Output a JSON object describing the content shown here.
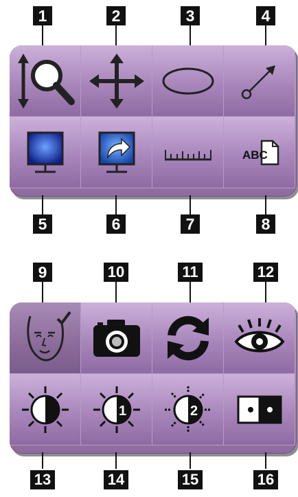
{
  "top_toolbar": {
    "callouts": [
      "1",
      "2",
      "3",
      "4",
      "5",
      "6",
      "7",
      "8"
    ],
    "tools": [
      {
        "icon": "zoom-magnifier-icon"
      },
      {
        "icon": "pan-move-icon"
      },
      {
        "icon": "ellipse-roi-icon"
      },
      {
        "icon": "arrow-annotation-icon"
      },
      {
        "icon": "monitor-icon"
      },
      {
        "icon": "monitor-share-icon"
      },
      {
        "icon": "ruler-icon"
      },
      {
        "icon": "text-annotation-icon",
        "text": "ABC"
      }
    ]
  },
  "bottom_toolbar": {
    "callouts": [
      "9",
      "10",
      "11",
      "12",
      "13",
      "14",
      "15",
      "16"
    ],
    "tools": [
      {
        "icon": "face-check-icon",
        "active": true
      },
      {
        "icon": "camera-icon"
      },
      {
        "icon": "refresh-icon"
      },
      {
        "icon": "eye-icon"
      },
      {
        "icon": "window-level-icon"
      },
      {
        "icon": "window-level-preset-icon",
        "text": "1"
      },
      {
        "icon": "window-level-preset-icon",
        "text": "2"
      },
      {
        "icon": "dual-view-icon"
      }
    ]
  },
  "colors": {
    "panel": "#a886bb",
    "active_cell": "#8a6b99",
    "callout": "#111111"
  }
}
